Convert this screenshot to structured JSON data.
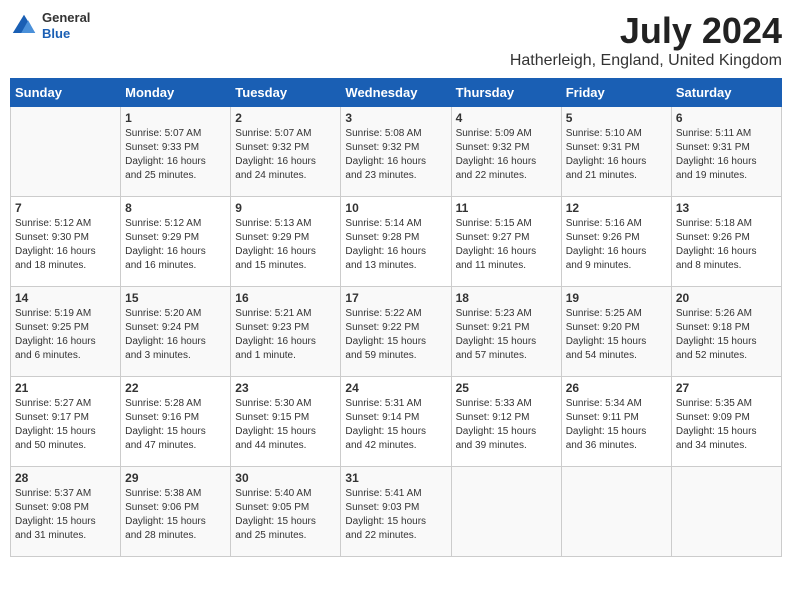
{
  "header": {
    "logo_line1": "General",
    "logo_line2": "Blue",
    "title": "July 2024",
    "subtitle": "Hatherleigh, England, United Kingdom"
  },
  "calendar": {
    "days_of_week": [
      "Sunday",
      "Monday",
      "Tuesday",
      "Wednesday",
      "Thursday",
      "Friday",
      "Saturday"
    ],
    "weeks": [
      [
        {
          "day": "",
          "info": ""
        },
        {
          "day": "1",
          "info": "Sunrise: 5:07 AM\nSunset: 9:33 PM\nDaylight: 16 hours\nand 25 minutes."
        },
        {
          "day": "2",
          "info": "Sunrise: 5:07 AM\nSunset: 9:32 PM\nDaylight: 16 hours\nand 24 minutes."
        },
        {
          "day": "3",
          "info": "Sunrise: 5:08 AM\nSunset: 9:32 PM\nDaylight: 16 hours\nand 23 minutes."
        },
        {
          "day": "4",
          "info": "Sunrise: 5:09 AM\nSunset: 9:32 PM\nDaylight: 16 hours\nand 22 minutes."
        },
        {
          "day": "5",
          "info": "Sunrise: 5:10 AM\nSunset: 9:31 PM\nDaylight: 16 hours\nand 21 minutes."
        },
        {
          "day": "6",
          "info": "Sunrise: 5:11 AM\nSunset: 9:31 PM\nDaylight: 16 hours\nand 19 minutes."
        }
      ],
      [
        {
          "day": "7",
          "info": "Sunrise: 5:12 AM\nSunset: 9:30 PM\nDaylight: 16 hours\nand 18 minutes."
        },
        {
          "day": "8",
          "info": "Sunrise: 5:12 AM\nSunset: 9:29 PM\nDaylight: 16 hours\nand 16 minutes."
        },
        {
          "day": "9",
          "info": "Sunrise: 5:13 AM\nSunset: 9:29 PM\nDaylight: 16 hours\nand 15 minutes."
        },
        {
          "day": "10",
          "info": "Sunrise: 5:14 AM\nSunset: 9:28 PM\nDaylight: 16 hours\nand 13 minutes."
        },
        {
          "day": "11",
          "info": "Sunrise: 5:15 AM\nSunset: 9:27 PM\nDaylight: 16 hours\nand 11 minutes."
        },
        {
          "day": "12",
          "info": "Sunrise: 5:16 AM\nSunset: 9:26 PM\nDaylight: 16 hours\nand 9 minutes."
        },
        {
          "day": "13",
          "info": "Sunrise: 5:18 AM\nSunset: 9:26 PM\nDaylight: 16 hours\nand 8 minutes."
        }
      ],
      [
        {
          "day": "14",
          "info": "Sunrise: 5:19 AM\nSunset: 9:25 PM\nDaylight: 16 hours\nand 6 minutes."
        },
        {
          "day": "15",
          "info": "Sunrise: 5:20 AM\nSunset: 9:24 PM\nDaylight: 16 hours\nand 3 minutes."
        },
        {
          "day": "16",
          "info": "Sunrise: 5:21 AM\nSunset: 9:23 PM\nDaylight: 16 hours\nand 1 minute."
        },
        {
          "day": "17",
          "info": "Sunrise: 5:22 AM\nSunset: 9:22 PM\nDaylight: 15 hours\nand 59 minutes."
        },
        {
          "day": "18",
          "info": "Sunrise: 5:23 AM\nSunset: 9:21 PM\nDaylight: 15 hours\nand 57 minutes."
        },
        {
          "day": "19",
          "info": "Sunrise: 5:25 AM\nSunset: 9:20 PM\nDaylight: 15 hours\nand 54 minutes."
        },
        {
          "day": "20",
          "info": "Sunrise: 5:26 AM\nSunset: 9:18 PM\nDaylight: 15 hours\nand 52 minutes."
        }
      ],
      [
        {
          "day": "21",
          "info": "Sunrise: 5:27 AM\nSunset: 9:17 PM\nDaylight: 15 hours\nand 50 minutes."
        },
        {
          "day": "22",
          "info": "Sunrise: 5:28 AM\nSunset: 9:16 PM\nDaylight: 15 hours\nand 47 minutes."
        },
        {
          "day": "23",
          "info": "Sunrise: 5:30 AM\nSunset: 9:15 PM\nDaylight: 15 hours\nand 44 minutes."
        },
        {
          "day": "24",
          "info": "Sunrise: 5:31 AM\nSunset: 9:14 PM\nDaylight: 15 hours\nand 42 minutes."
        },
        {
          "day": "25",
          "info": "Sunrise: 5:33 AM\nSunset: 9:12 PM\nDaylight: 15 hours\nand 39 minutes."
        },
        {
          "day": "26",
          "info": "Sunrise: 5:34 AM\nSunset: 9:11 PM\nDaylight: 15 hours\nand 36 minutes."
        },
        {
          "day": "27",
          "info": "Sunrise: 5:35 AM\nSunset: 9:09 PM\nDaylight: 15 hours\nand 34 minutes."
        }
      ],
      [
        {
          "day": "28",
          "info": "Sunrise: 5:37 AM\nSunset: 9:08 PM\nDaylight: 15 hours\nand 31 minutes."
        },
        {
          "day": "29",
          "info": "Sunrise: 5:38 AM\nSunset: 9:06 PM\nDaylight: 15 hours\nand 28 minutes."
        },
        {
          "day": "30",
          "info": "Sunrise: 5:40 AM\nSunset: 9:05 PM\nDaylight: 15 hours\nand 25 minutes."
        },
        {
          "day": "31",
          "info": "Sunrise: 5:41 AM\nSunset: 9:03 PM\nDaylight: 15 hours\nand 22 minutes."
        },
        {
          "day": "",
          "info": ""
        },
        {
          "day": "",
          "info": ""
        },
        {
          "day": "",
          "info": ""
        }
      ]
    ]
  }
}
